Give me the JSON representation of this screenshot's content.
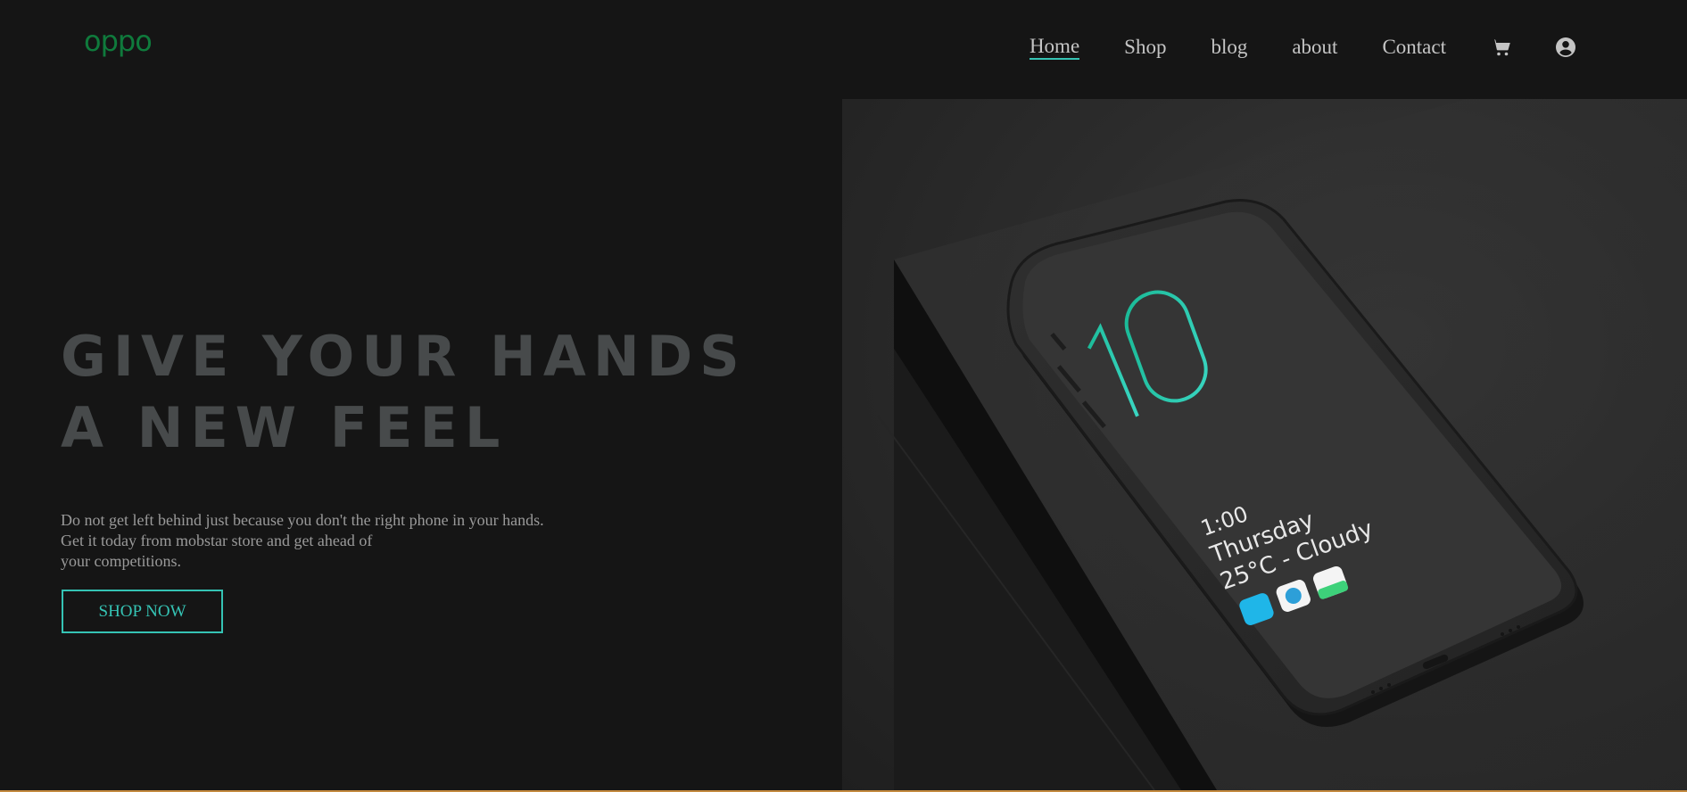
{
  "brand": {
    "logo_text": "oppo",
    "logo_color": "#0f7a3c"
  },
  "nav": {
    "items": [
      {
        "label": "Home",
        "active": true
      },
      {
        "label": "Shop",
        "active": false
      },
      {
        "label": "blog",
        "active": false
      },
      {
        "label": "about",
        "active": false
      },
      {
        "label": "Contact",
        "active": false
      }
    ],
    "icons": [
      "cart-icon",
      "user-circle-icon"
    ],
    "accent_color": "#35c3b4"
  },
  "hero": {
    "title_line1": "GIVE YOUR HANDS",
    "title_line2": "A NEW FEEL",
    "desc_line1": "Do not get left behind just because you don't the right phone in your hands.",
    "desc_line2": "Get it today from mobstar store and get ahead of",
    "desc_line3": "your competitions.",
    "cta_label": "SHOP NOW"
  },
  "phone_screen": {
    "big_number": "10",
    "time": "1:00",
    "day": "Thursday",
    "weather": "25°C - Cloudy"
  }
}
